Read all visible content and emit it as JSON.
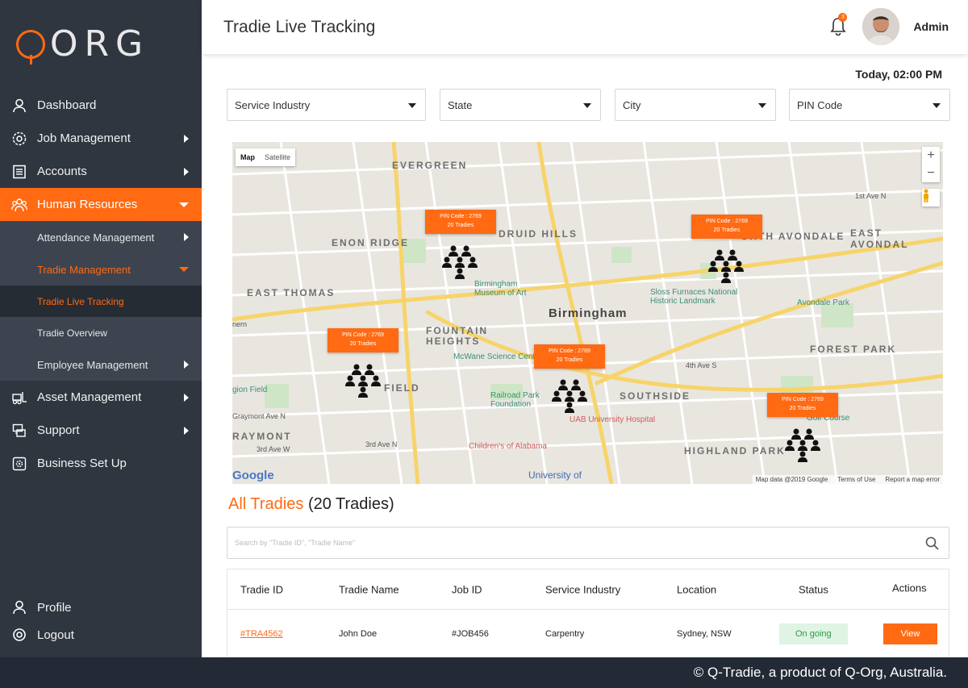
{
  "brand": {
    "logo_text": "ORG"
  },
  "sidebar": {
    "items": [
      {
        "label": "Dashboard"
      },
      {
        "label": "Job Management"
      },
      {
        "label": "Accounts"
      },
      {
        "label": "Human Resources"
      },
      {
        "label": "Asset Management"
      },
      {
        "label": "Support"
      },
      {
        "label": "Business Set Up"
      }
    ],
    "hr_sub": [
      {
        "label": "Attendance Management"
      },
      {
        "label": "Tradie Management"
      },
      {
        "label": "Employee  Management"
      }
    ],
    "tradie_sub": [
      {
        "label": "Tradie Live Tracking"
      },
      {
        "label": "Tradie Overview"
      }
    ],
    "bottom": [
      {
        "label": "Profile"
      },
      {
        "label": "Logout"
      }
    ]
  },
  "header": {
    "title": "Tradie Live Tracking",
    "notifications": "3",
    "user": "Admin"
  },
  "datetime": "Today, 02:00 PM",
  "filters": {
    "service_industry": "Service Industry",
    "state": "State",
    "city": "City",
    "pin_code": "PIN Code"
  },
  "map": {
    "toggle_map": "Map",
    "toggle_satellite": "Satellite",
    "zoom_in": "+",
    "zoom_out": "−",
    "pins": [
      {
        "line1": "PIN Code : 2769",
        "line2": "20 Tradies"
      },
      {
        "line1": "PIN Code : 2769",
        "line2": "20 Tradies"
      },
      {
        "line1": "PIN Code : 2769",
        "line2": "20 Tradies"
      },
      {
        "line1": "PIN Code : 2769",
        "line2": "20 Tradies"
      },
      {
        "line1": "PIN Code : 2769",
        "line2": "20 Tradies"
      }
    ],
    "labels": {
      "evergreen": "EVERGREEN",
      "enon_ridge": "ENON RIDGE",
      "druid_hills": "DRUID HILLS",
      "north_avondale": "ORTH AVONDALE",
      "east_avondale": "EAST AVONDAL",
      "east_thomas": "EAST THOMAS",
      "birmingham": "Birmingham",
      "fountain_heights": "FOUNTAIN HEIGHTS",
      "forest_park": "FOREST PARK",
      "southside": "SOUTHSIDE",
      "highland_park": "HIGHLAND PARK",
      "raymont": "RAYMONT",
      "field": "FIELD",
      "museum": "Birmingham Museum of Art",
      "sloss": "Sloss Furnaces National Historic Landmark",
      "avondale_park": "Avondale Park",
      "mcwane": "McWane Science Center",
      "railroad_park": "Railroad Park Foundation",
      "uab": "UAB University Hospital",
      "childrens": "Children's of Alabama",
      "university": "University of",
      "golf": "Golf Course",
      "gion_field": "gion Field",
      "nern": "nern",
      "graymont_ave": "Graymont Ave N",
      "third_ave": "3rd Ave W",
      "third_ave_n": "3rd Ave N",
      "fourth_ave_s": "4th Ave S",
      "first_ave_n": "1st Ave N"
    },
    "google": "Google",
    "footer_data": "Map data @2019 Google",
    "footer_terms": "Terms of Use",
    "footer_report": "Report a map error"
  },
  "tradies": {
    "title_highlight": "All Tradies",
    "title_count": "(20 Tradies)",
    "search_placeholder": "Search by \"Tradie ID\", \"Tradie Name\"",
    "columns": [
      "Tradie ID",
      "Tradie Name",
      "Job ID",
      "Service Industry",
      "Location",
      "Status",
      "Actions"
    ],
    "rows": [
      {
        "tradie_id": "#TRA4562",
        "name": "John Doe",
        "job_id": "#JOB456",
        "industry": "Carpentry",
        "location": "Sydney, NSW",
        "status": "On going",
        "action": "View"
      }
    ]
  },
  "footer": {
    "text": "© Q-Tradie, a product of Q-Org, Australia."
  },
  "colors": {
    "accent": "#ff6a13",
    "sidebar": "#2f3640",
    "footer": "#232a35",
    "status_bg": "#dff4e3",
    "status_text": "#2e9a48"
  }
}
